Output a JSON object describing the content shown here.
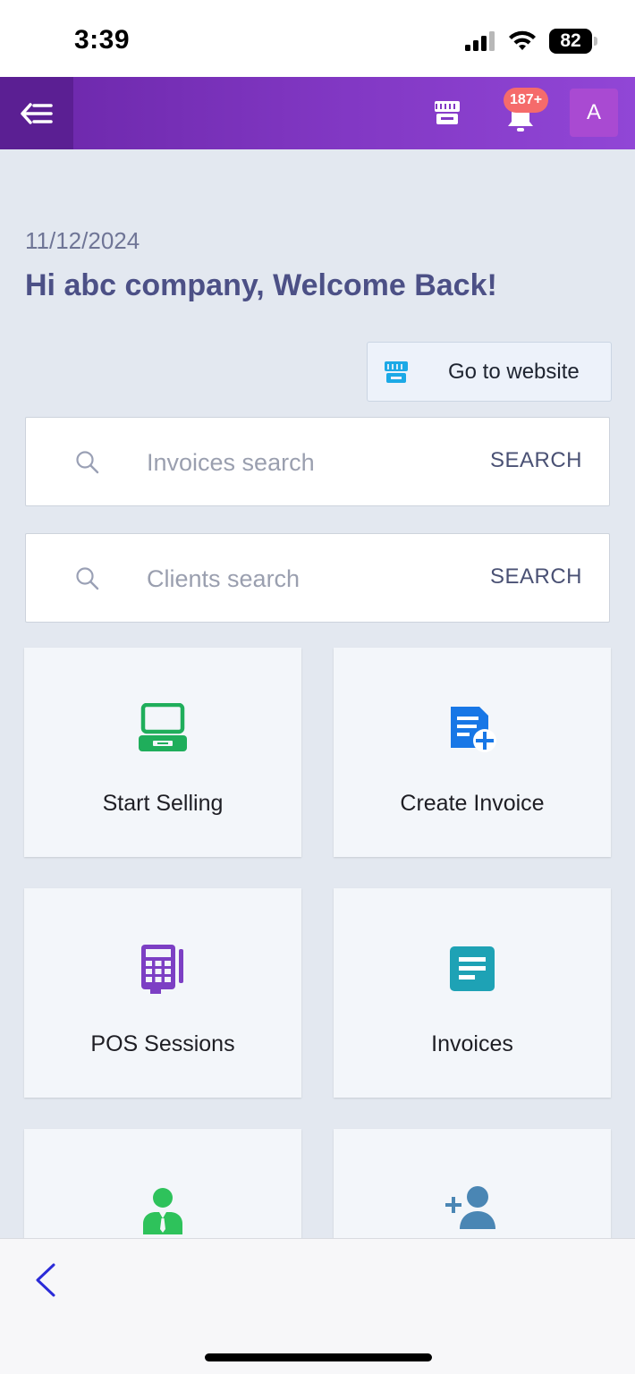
{
  "status_bar": {
    "time": "3:39",
    "battery": "82"
  },
  "header": {
    "notification_count": "187+",
    "avatar_initial": "A"
  },
  "greeting": {
    "date": "11/12/2024",
    "message": "Hi abc company, Welcome Back!"
  },
  "website_button": {
    "label": "Go to website"
  },
  "searches": [
    {
      "placeholder": "Invoices search",
      "button": "SEARCH"
    },
    {
      "placeholder": "Clients search",
      "button": "SEARCH"
    }
  ],
  "tiles": [
    {
      "label": "Start Selling",
      "icon": "pos-terminal-icon",
      "color": "#1fae5b"
    },
    {
      "label": "Create Invoice",
      "icon": "document-add-icon",
      "color": "#1877e6"
    },
    {
      "label": "POS Sessions",
      "icon": "calculator-icon",
      "color": "#7c3fc4"
    },
    {
      "label": "Invoices",
      "icon": "document-lines-icon",
      "color": "#1ea2b5"
    },
    {
      "label": "",
      "icon": "employee-icon",
      "color": "#2ec25b"
    },
    {
      "label": "",
      "icon": "add-user-icon",
      "color": "#4a86b4"
    }
  ]
}
